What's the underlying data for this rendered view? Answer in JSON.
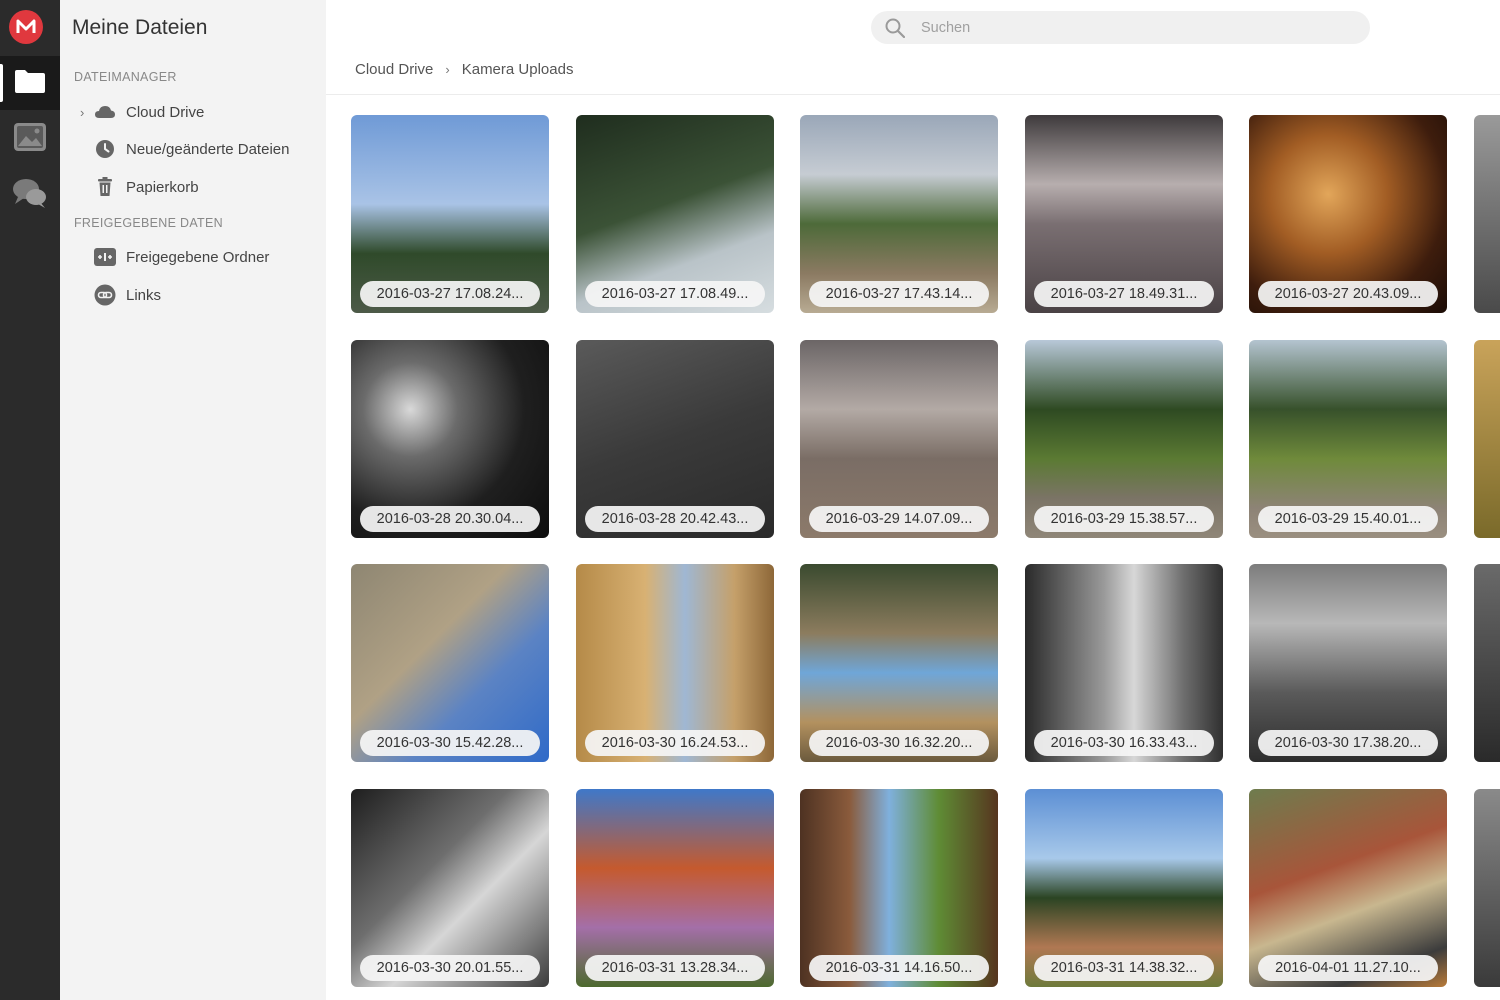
{
  "app": {
    "logo_letter": "M"
  },
  "sidebar": {
    "title": "Meine Dateien",
    "sections": [
      {
        "label": "DATEIMANAGER"
      },
      {
        "label": "FREIGEGEBENE DATEN"
      }
    ],
    "items": [
      {
        "label": "Cloud Drive",
        "icon": "cloud-icon",
        "expandable": true
      },
      {
        "label": "Neue/geänderte Dateien",
        "icon": "clock-icon"
      },
      {
        "label": "Papierkorb",
        "icon": "trash-icon"
      },
      {
        "label": "Freigegebene Ordner",
        "icon": "shared-folder-icon"
      },
      {
        "label": "Links",
        "icon": "link-icon"
      }
    ]
  },
  "search": {
    "placeholder": "Suchen"
  },
  "breadcrumb": {
    "items": [
      "Cloud Drive",
      "Kamera Uploads"
    ]
  },
  "photos": [
    {
      "name": "2016-03-27 17.08.24..."
    },
    {
      "name": "2016-03-27 17.08.49..."
    },
    {
      "name": "2016-03-27 17.43.14..."
    },
    {
      "name": "2016-03-27 18.49.31..."
    },
    {
      "name": "2016-03-27 20.43.09..."
    },
    {
      "name": "2016-03-28 20.30.04..."
    },
    {
      "name": "2016-03-28 20.42.43..."
    },
    {
      "name": "2016-03-29 14.07.09..."
    },
    {
      "name": "2016-03-29 15.38.57..."
    },
    {
      "name": "2016-03-29 15.40.01..."
    },
    {
      "name": "2016-03-30 15.42.28..."
    },
    {
      "name": "2016-03-30 16.24.53..."
    },
    {
      "name": "2016-03-30 16.32.20..."
    },
    {
      "name": "2016-03-30 16.33.43..."
    },
    {
      "name": "2016-03-30 17.38.20..."
    },
    {
      "name": "2016-03-30 20.01.55..."
    },
    {
      "name": "2016-03-31 13.28.34..."
    },
    {
      "name": "2016-03-31 14.16.50..."
    },
    {
      "name": "2016-03-31 14.38.32..."
    },
    {
      "name": "2016-04-01 11.27.10..."
    }
  ],
  "colors": {
    "brand": "#e0383e",
    "rail": "#2b2b2b",
    "sidebar": "#f3f3f3"
  }
}
